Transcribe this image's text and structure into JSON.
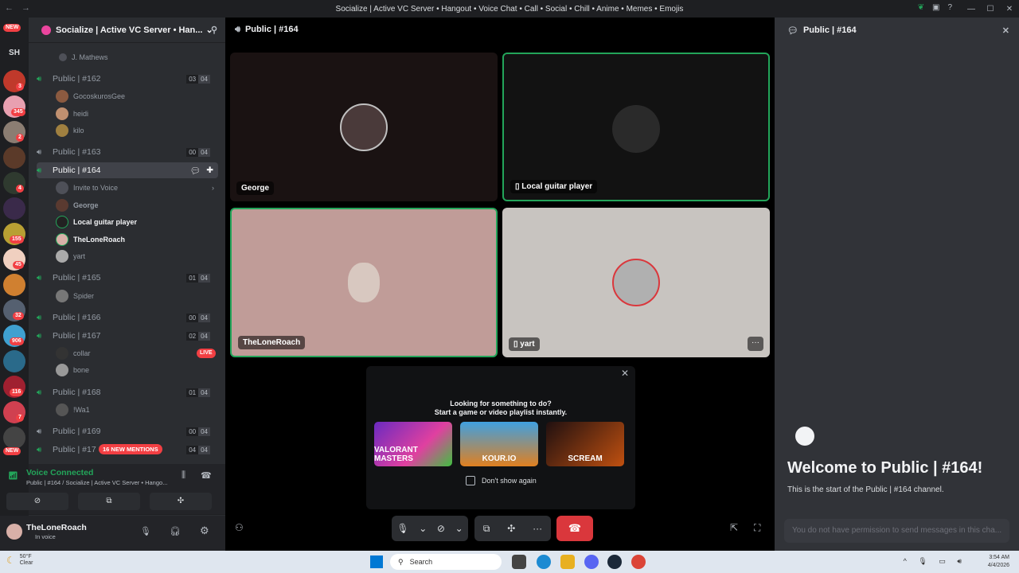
{
  "window": {
    "title": "Socialize | Active VC Server • Hangout • Voice Chat • Call • Social • Chill • Anime • Memes • Emojis"
  },
  "servers": {
    "new_top": "NEW",
    "sh_label": "SH",
    "badges": [
      "3",
      "345",
      "2",
      "4",
      "155",
      "45",
      "32",
      "906",
      "116",
      "7"
    ],
    "new_bottom": "NEW"
  },
  "guild": {
    "name": "Socialize | Active VC Server • Han...",
    "top_user": "J. Mathews",
    "channels": [
      {
        "name": "Public | #162",
        "count_a": "03",
        "count_b": "04",
        "users": [
          "GocoskurosGee",
          "heidi",
          "kilo"
        ]
      },
      {
        "name": "Public | #163",
        "count_a": "00",
        "count_b": "04"
      },
      {
        "name": "Public | #164",
        "invite": "Invite to Voice",
        "users": [
          "George",
          "Local guitar player",
          "TheLoneRoach",
          "yart"
        ]
      },
      {
        "name": "Public | #165",
        "count_a": "01",
        "count_b": "04",
        "users": [
          "Spider"
        ]
      },
      {
        "name": "Public | #166",
        "count_a": "00",
        "count_b": "04"
      },
      {
        "name": "Public | #167",
        "count_a": "02",
        "count_b": "04",
        "users": [
          "collar",
          "bone"
        ],
        "live": "LIVE"
      },
      {
        "name": "Public | #168",
        "count_a": "01",
        "count_b": "04",
        "users": [
          "!Wa1"
        ]
      },
      {
        "name": "Public | #169",
        "count_a": "00",
        "count_b": "04"
      },
      {
        "name": "Public | #17",
        "count_a": "04",
        "count_b": "04"
      }
    ],
    "mentions_pill": "16 NEW MENTIONS"
  },
  "voice": {
    "status": "Voice Connected",
    "location": "Public | #164 / Socialize | Active VC Server • Hango..."
  },
  "user_panel": {
    "name": "TheLoneRoach",
    "status": "In voice"
  },
  "stage": {
    "title": "Public | #164",
    "tiles": [
      {
        "label": "George"
      },
      {
        "label": "Local guitar player"
      },
      {
        "label": "TheLoneRoach"
      },
      {
        "label": "yart"
      }
    ],
    "activity": {
      "line1": "Looking for something to do?",
      "line2": "Start a game or video playlist instantly.",
      "cards": [
        "VALORANT MASTERS",
        "KOUR.IO",
        "SCREAM"
      ],
      "dont_show": "Don't show again"
    }
  },
  "chat": {
    "title": "Public | #164",
    "welcome": "Welcome to Public | #164!",
    "welcome_sub": "This is the start of the Public | #164 channel.",
    "input_placeholder": "You do not have permission to send messages in this cha..."
  },
  "taskbar": {
    "weather_temp": "50°F",
    "weather_desc": "Clear",
    "search": "Search",
    "time": "3:54 AM",
    "date": "4/4/2026"
  },
  "colors": {
    "accent": "#23a55a",
    "danger": "#da373c",
    "background": "#1e1f22"
  }
}
